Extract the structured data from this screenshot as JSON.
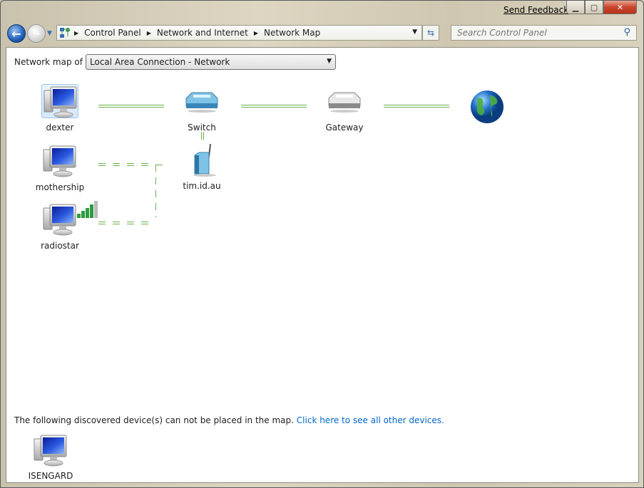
{
  "titlebar": {
    "send_feedback": "Send Feedback",
    "minimize": "minimize",
    "maximize": "maximize",
    "close": "close"
  },
  "navigation": {
    "breadcrumb": [
      "Control Panel",
      "Network and Internet",
      "Network Map"
    ],
    "search_placeholder": "Search Control Panel"
  },
  "main": {
    "network_map_label": "Network map of",
    "connection_selected": "Local Area Connection - Network",
    "nodes": [
      {
        "name": "dexter",
        "type": "computer",
        "selected": true
      },
      {
        "name": "Switch",
        "type": "switch"
      },
      {
        "name": "Gateway",
        "type": "gateway"
      },
      {
        "name": "",
        "type": "internet"
      },
      {
        "name": "mothership",
        "type": "computer"
      },
      {
        "name": "tim.id.au",
        "type": "wireless-access-point"
      },
      {
        "name": "radiostar",
        "type": "computer",
        "wireless_signal": "full"
      }
    ],
    "connections": [
      {
        "from": "dexter",
        "to": "Switch",
        "kind": "wired"
      },
      {
        "from": "Switch",
        "to": "Gateway",
        "kind": "wired"
      },
      {
        "from": "Gateway",
        "to": "Internet",
        "kind": "wired"
      },
      {
        "from": "Switch",
        "to": "tim.id.au",
        "kind": "wired"
      },
      {
        "from": "mothership",
        "to": "tim.id.au",
        "kind": "wireless"
      },
      {
        "from": "radiostar",
        "to": "tim.id.au",
        "kind": "wireless"
      }
    ],
    "unplaced_text": "The following discovered device(s) can not be placed in the map.",
    "unplaced_link": "Click here to see all other devices.",
    "unplaced_devices": [
      {
        "name": "ISENGARD",
        "type": "computer"
      }
    ]
  },
  "colors": {
    "link": "#0066cc",
    "connection_line": "#6ab04c",
    "selection": "#d5e8fa"
  }
}
